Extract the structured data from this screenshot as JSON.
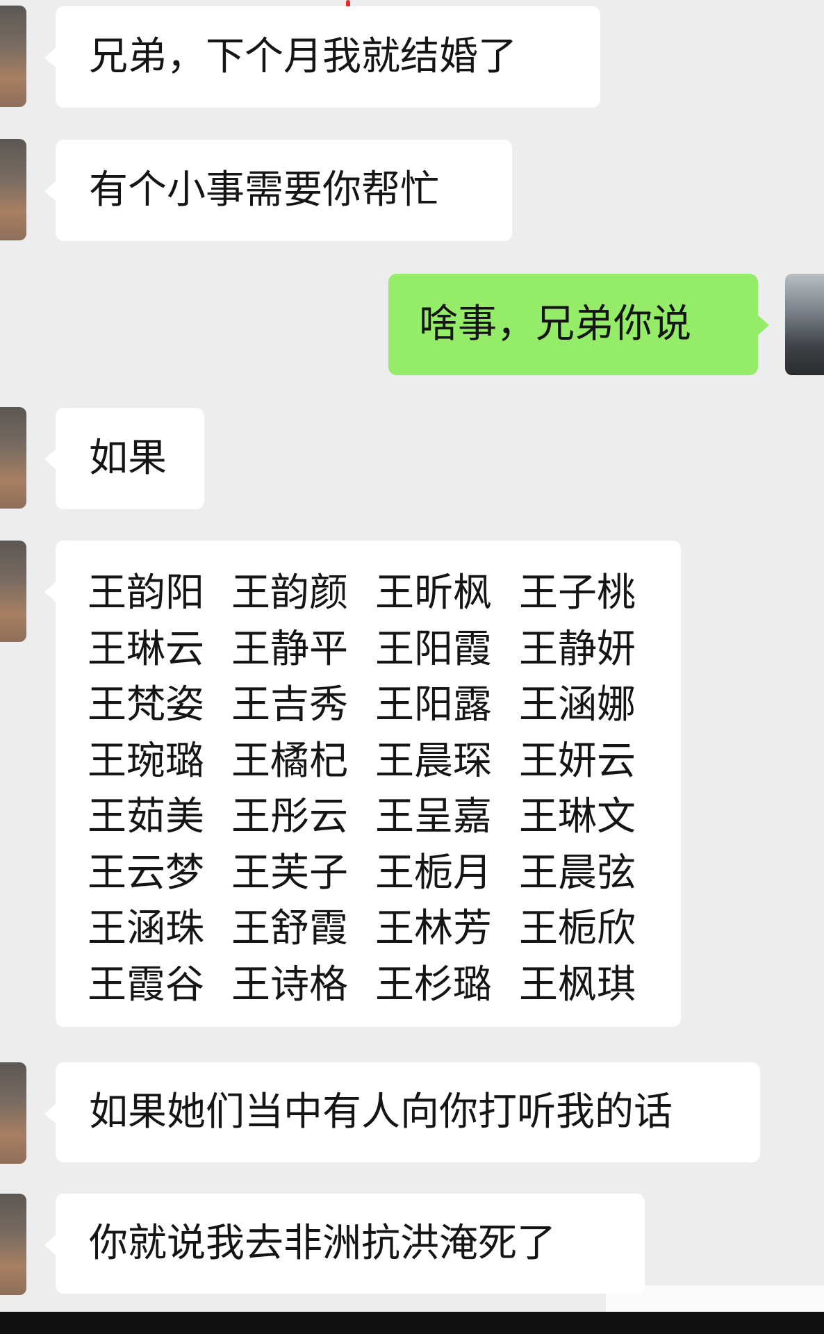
{
  "messages": [
    {
      "sender": "friend",
      "text": "兄弟，下个月我就结婚了"
    },
    {
      "sender": "friend",
      "text": "有个小事需要你帮忙"
    },
    {
      "sender": "me",
      "text": "啥事，兄弟你说"
    },
    {
      "sender": "friend",
      "text": "如果"
    },
    {
      "sender": "friend",
      "type": "name-list",
      "names": [
        "王韵阳",
        "王韵颜",
        "王昕枫",
        "王子桃",
        "王琳云",
        "王静平",
        "王阳霞",
        "王静妍",
        "王梵姿",
        "王吉秀",
        "王阳露",
        "王涵娜",
        "王琬璐",
        "王橘杞",
        "王晨琛",
        "王妍云",
        "王茹美",
        "王彤云",
        "王呈嘉",
        "王琳文",
        "王云梦",
        "王芙子",
        "王栀月",
        "王晨弦",
        "王涵珠",
        "王舒霞",
        "王林芳",
        "王栀欣",
        "王霞谷",
        "王诗格",
        "王杉璐",
        "王枫琪"
      ]
    },
    {
      "sender": "friend",
      "text": "如果她们当中有人向你打听我的话"
    },
    {
      "sender": "friend",
      "text": "你就说我去非洲抗洪淹死了"
    }
  ],
  "colors": {
    "chat_background": "#ededed",
    "friend_bubble": "#ffffff",
    "my_bubble": "#95ec69",
    "text": "#151515"
  }
}
